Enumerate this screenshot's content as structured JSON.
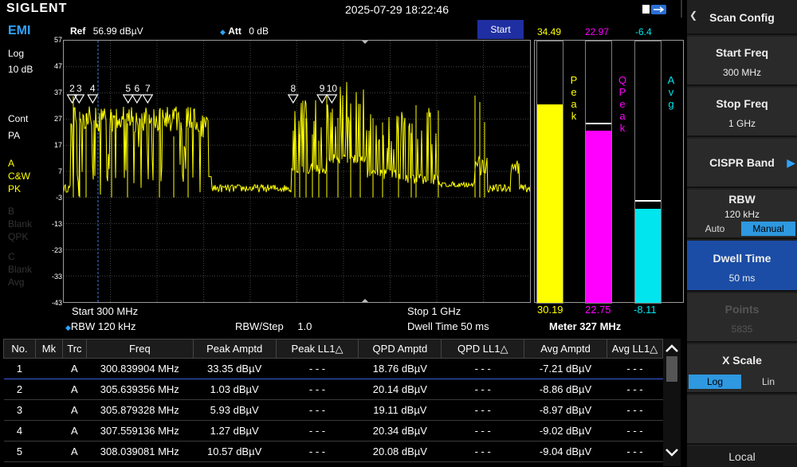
{
  "topbar": {
    "logo": "SIGLENT",
    "datetime": "2025-07-29 18:22:46"
  },
  "left": {
    "mode": "EMI",
    "scale": "Log",
    "div": "10 dB",
    "sweep": "Cont",
    "preamp": "PA",
    "trace_a": {
      "letter": "A",
      "type": "C&W",
      "det": "PK"
    },
    "trace_b": {
      "letter": "B",
      "type": "Blank",
      "det": "QPK"
    },
    "trace_c": {
      "letter": "C",
      "type": "Blank",
      "det": "Avg"
    }
  },
  "header": {
    "ref_label": "Ref",
    "ref_value": "56.99 dBµV",
    "att_label": "Att",
    "att_value": "0 dB",
    "start_button": "Start"
  },
  "yaxis": [
    "57",
    "47",
    "37",
    "27",
    "17",
    "7",
    "-3",
    "-13",
    "-23",
    "-33",
    "-43"
  ],
  "markers": [
    {
      "label": "2",
      "x": 0.018
    },
    {
      "label": "3",
      "x": 0.033
    },
    {
      "label": "4",
      "x": 0.062
    },
    {
      "label": "5",
      "x": 0.138
    },
    {
      "label": "6",
      "x": 0.157
    },
    {
      "label": "7",
      "x": 0.18
    },
    {
      "label": "8",
      "x": 0.492
    },
    {
      "label": "9",
      "x": 0.554
    },
    {
      "label": "10",
      "x": 0.575
    }
  ],
  "meters": {
    "peak": {
      "label": "Peak",
      "top_value": "34.49",
      "bottom_value": "30.19",
      "color": "#ffff00",
      "level": 0.76,
      "hold": 0.79
    },
    "qpeak": {
      "label": "QPeak",
      "top_value": "22.97",
      "bottom_value": "22.75",
      "color": "#ff00ff",
      "level": 0.66,
      "hold": 0.665
    },
    "avg": {
      "label": "Avg",
      "top_value": "-6.4",
      "bottom_value": "-8.11",
      "color": "#00e5ee",
      "level": 0.36,
      "hold": 0.37
    },
    "meter_freq": "Meter 327 MHz"
  },
  "bottom": {
    "start": "Start  300 MHz",
    "rbw": "RBW  120 kHz",
    "rbw_step_label": "RBW/Step",
    "rbw_step_value": "1.0",
    "stop": "Stop  1 GHz",
    "dwell": "Dwell Time  50 ms"
  },
  "table": {
    "headers": [
      "No.",
      "Mk",
      "Trc",
      "Freq",
      "Peak Amptd",
      "Peak LL1△",
      "QPD Amptd",
      "QPD LL1△",
      "Avg Amptd",
      "Avg LL1△"
    ],
    "rows": [
      [
        "1",
        "",
        "A",
        "300.839904 MHz",
        "33.35 dBµV",
        "- - -",
        "18.76 dBµV",
        "- - -",
        "-7.21 dBµV",
        "- - -"
      ],
      [
        "2",
        "",
        "A",
        "305.639356 MHz",
        "1.03 dBµV",
        "- - -",
        "20.14 dBµV",
        "- - -",
        "-8.86 dBµV",
        "- - -"
      ],
      [
        "3",
        "",
        "A",
        "305.879328 MHz",
        "5.93 dBµV",
        "- - -",
        "19.11 dBµV",
        "- - -",
        "-8.97 dBµV",
        "- - -"
      ],
      [
        "4",
        "",
        "A",
        "307.559136 MHz",
        "1.27 dBµV",
        "- - -",
        "20.34 dBµV",
        "- - -",
        "-9.02 dBµV",
        "- - -"
      ],
      [
        "5",
        "",
        "A",
        "308.039081 MHz",
        "10.57 dBµV",
        "- - -",
        "20.08 dBµV",
        "- - -",
        "-9.04 dBµV",
        "- - -"
      ]
    ]
  },
  "rpanel": {
    "title": "Scan Config",
    "start_freq": {
      "label": "Start Freq",
      "value": "300 MHz"
    },
    "stop_freq": {
      "label": "Stop Freq",
      "value": "1 GHz"
    },
    "cispr": {
      "label": "CISPR Band"
    },
    "rbw": {
      "label": "RBW",
      "value": "120 kHz",
      "opt_auto": "Auto",
      "opt_manual": "Manual"
    },
    "dwell": {
      "label": "Dwell Time",
      "value": "50 ms"
    },
    "points": {
      "label": "Points",
      "value": "5835"
    },
    "xscale": {
      "label": "X Scale",
      "opt_log": "Log",
      "opt_lin": "Lin"
    },
    "local": "Local"
  }
}
